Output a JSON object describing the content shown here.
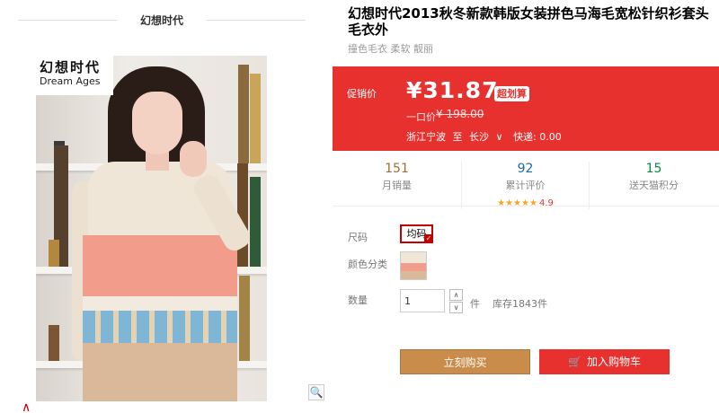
{
  "shop": {
    "name": "幻想时代"
  },
  "photo": {
    "logo_cn": "幻想时代",
    "logo_en": "Dream Ages"
  },
  "product": {
    "title": "幻想时代2013秋冬新款韩版女装拼色马海毛宽松针织衫套头毛衣外",
    "tags": "撞色毛衣 柔软 靓丽"
  },
  "promo": {
    "label": "促销价",
    "price": "¥31.87",
    "badge": "超划算",
    "orig_label": "一口价",
    "orig_price": "¥ 198.00",
    "ship_from": "浙江宁波",
    "ship_to_lbl": "至",
    "ship_to": "长沙",
    "chevron": "∨",
    "ship_fee": "快递: 0.00"
  },
  "stats": [
    {
      "num": "151",
      "label": "月销量"
    },
    {
      "num": "92",
      "label": "累计评价",
      "stars": "★★★★★",
      "rating": "4.9"
    },
    {
      "num": "15",
      "label": "送天猫积分"
    }
  ],
  "options": {
    "size_label": "尺码",
    "size_value": "均码",
    "color_label": "颜色分类",
    "qty_label": "数量",
    "qty_value": "1",
    "qty_up": "∧",
    "qty_down": "∨",
    "unit": "件",
    "stock": "库存1843件"
  },
  "buttons": {
    "buy": "立刻购买",
    "cart": "加入购物车"
  },
  "colors": {
    "accent": "#e7312e",
    "buy": "#c98c4a"
  }
}
